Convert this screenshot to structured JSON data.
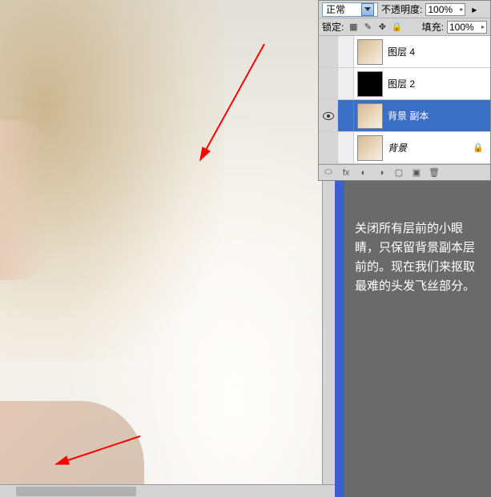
{
  "panel": {
    "blend_mode": "正常",
    "opacity_label": "不透明度:",
    "opacity_value": "100%",
    "lock_label": "锁定:",
    "fill_label": "填充:",
    "fill_value": "100%",
    "layers": [
      {
        "name": "图层 4",
        "visible": false,
        "selected": false,
        "thumb": "person",
        "italic": false,
        "locked": false
      },
      {
        "name": "图层 2",
        "visible": false,
        "selected": false,
        "thumb": "black",
        "italic": false,
        "locked": false
      },
      {
        "name": "背景 副本",
        "visible": true,
        "selected": true,
        "thumb": "person",
        "italic": false,
        "locked": false
      },
      {
        "name": "背景",
        "visible": false,
        "selected": false,
        "thumb": "person",
        "italic": true,
        "locked": true
      }
    ]
  },
  "instruction": "关闭所有层前的小眼睛，只保留背景副本层前的。现在我们来抠取最难的头发飞丝部分。"
}
